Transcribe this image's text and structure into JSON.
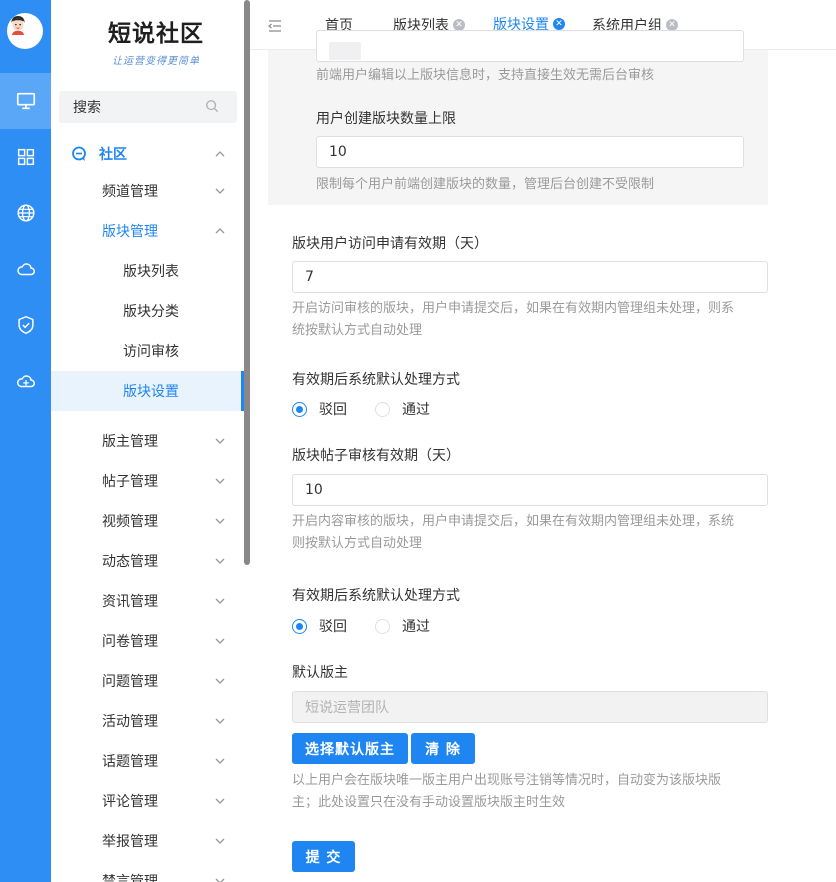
{
  "colors": {
    "primary": "#1f86f1",
    "rail": "#2f8ef4"
  },
  "rail": {
    "icons": [
      "monitor-icon",
      "grid-icon",
      "globe-icon",
      "cloud-icon",
      "shield-icon",
      "cloud-sync-icon"
    ]
  },
  "sidebar": {
    "logo_title": "短说社区",
    "logo_subtitle": "让运营变得更简单",
    "search_placeholder": "搜索",
    "menu": {
      "community": "社区",
      "channel": "频道管理",
      "section": "版块管理",
      "section_list": "版块列表",
      "section_category": "版块分类",
      "access_review": "访问审核",
      "section_settings": "版块设置",
      "moderator": "版主管理",
      "posts": "帖子管理",
      "videos": "视频管理",
      "dynamics": "动态管理",
      "news": "资讯管理",
      "survey": "问卷管理",
      "questions": "问题管理",
      "activities": "活动管理",
      "topics": "话题管理",
      "comments": "评论管理",
      "reports": "举报管理",
      "mute": "禁言管理"
    }
  },
  "tabs": {
    "home": "首页",
    "section_list": "版块列表",
    "section_settings": "版块设置",
    "system_user_group": "系统用户组"
  },
  "form": {
    "top_help": "前端用户编辑以上版块信息时，支持直接生效无需后台审核",
    "create_limit_label": "用户创建版块数量上限",
    "create_limit_value": "10",
    "create_limit_help": "限制每个用户前端创建版块的数量，管理后台创建不受限制",
    "access_validity_label": "版块用户访问申请有效期（天）",
    "access_validity_value": "7",
    "access_validity_help_1": "开启访问审核的版块，用户申请提交后，如果在有效期内管理组未处理，则系",
    "access_validity_help_2": "统按默认方式自动处理",
    "default_handle_label_1": "有效期后系统默认处理方式",
    "reject_label": "驳回",
    "pass_label": "通过",
    "post_validity_label": "版块帖子审核有效期（天）",
    "post_validity_value": "10",
    "post_validity_help_1": "开启内容审核的版块，用户申请提交后，如果在有效期内管理组未处理，系统",
    "post_validity_help_2": "则按默认方式自动处理",
    "default_handle_label_2": "有效期后系统默认处理方式",
    "default_moderator_label": "默认版主",
    "default_moderator_value": "短说运营团队",
    "select_moderator_btn": "选择默认版主",
    "clear_btn": "清 除",
    "moderator_help_1": "以上用户会在版块唯一版主用户出现账号注销等情况时，自动变为该版块版",
    "moderator_help_2": "主；此处设置只在没有手动设置版块版主时生效",
    "submit_btn": "提 交"
  }
}
